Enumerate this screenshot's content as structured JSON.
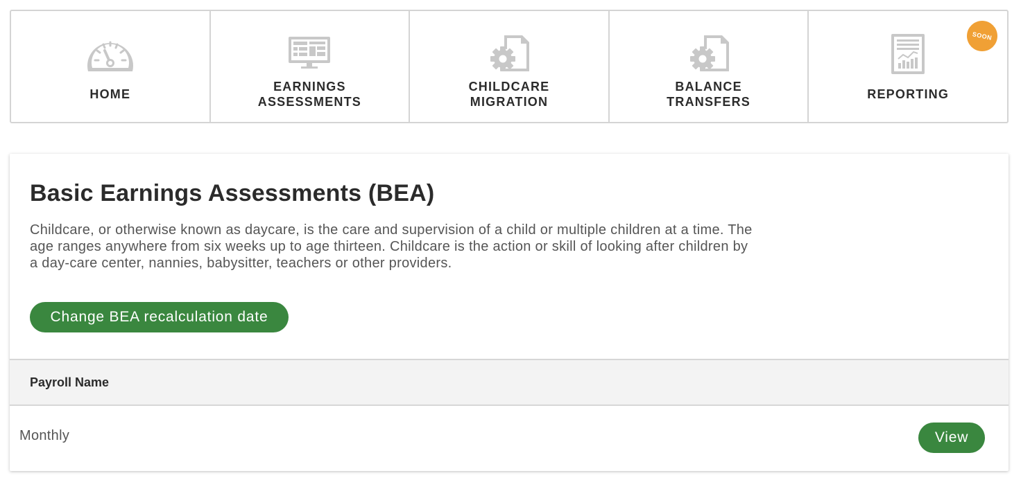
{
  "nav": {
    "items": [
      {
        "label": "HOME",
        "icon": "dashboard-gauge-icon"
      },
      {
        "label": "EARNINGS ASSESSMENTS",
        "icon": "monitor-icon"
      },
      {
        "label": "CHILDCARE MIGRATION",
        "icon": "gear-document-icon"
      },
      {
        "label": "BALANCE TRANSFERS",
        "icon": "gear-document-icon"
      },
      {
        "label": "REPORTING",
        "icon": "report-chart-icon",
        "badge": "SOON"
      }
    ],
    "icon_color": "#c8c8c8",
    "badge_color": "#f0a035"
  },
  "main": {
    "title": "Basic Earnings Assessments (BEA)",
    "description": "Childcare, or otherwise known as daycare, is the care and supervision of a child or multiple children at a time. The age ranges anywhere from six weeks up to age thirteen. Childcare is the action or skill of looking after children by a day-care center, nannies, babysitter, teachers or other providers.",
    "change_button_label": "Change BEA recalculation date",
    "button_color": "#3a873f"
  },
  "table": {
    "columns": [
      "Payroll Name"
    ],
    "rows": [
      {
        "name": "Monthly",
        "action_label": "View"
      }
    ]
  }
}
